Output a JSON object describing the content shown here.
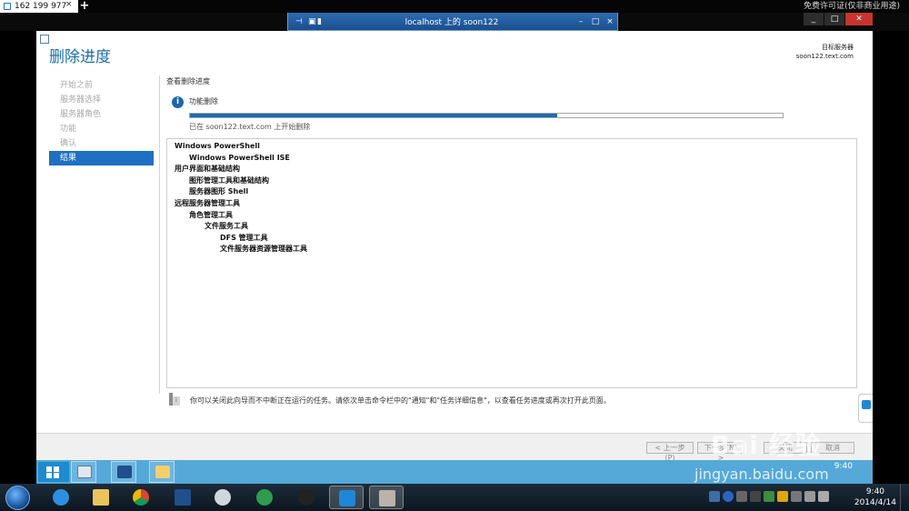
{
  "host_tab": {
    "title": "162 199 977",
    "close": "×",
    "new_tab": "+"
  },
  "host_top_right_text": "免费许可证(仅非商业用途)",
  "remote_bar": {
    "title": "localhost 上的 soon122",
    "minimize": "–",
    "restore": "□",
    "close": "×"
  },
  "window_controls": {
    "minimize": "_",
    "maximize": "□",
    "close": "✕"
  },
  "wizard": {
    "title": "删除进度",
    "target_label": "目标服务器",
    "target_server": "soon122.text.com",
    "nav": [
      {
        "label": "开始之前",
        "active": false
      },
      {
        "label": "服务器选择",
        "active": false
      },
      {
        "label": "服务器角色",
        "active": false
      },
      {
        "label": "功能",
        "active": false
      },
      {
        "label": "确认",
        "active": false
      },
      {
        "label": "结果",
        "active": true
      }
    ],
    "section_title": "查看删除进度",
    "feature_label": "功能删除",
    "progress_fraction": 0.62,
    "progress_text": "已在 soon122.text.com 上开始删除",
    "results": [
      {
        "text": "Windows PowerShell",
        "level": 0
      },
      {
        "text": "Windows PowerShell ISE",
        "level": 1
      },
      {
        "text": "用户界面和基础结构",
        "level": 0
      },
      {
        "text": "图形管理工具和基础结构",
        "level": 1
      },
      {
        "text": "服务器图形 Shell",
        "level": 1
      },
      {
        "text": "远程服务器管理工具",
        "level": 0
      },
      {
        "text": "角色管理工具",
        "level": 1
      },
      {
        "text": "文件服务工具",
        "level": 2
      },
      {
        "text": "DFS 管理工具",
        "level": 3
      },
      {
        "text": "文件服务器资源管理器工具",
        "level": 3
      }
    ],
    "note": "你可以关闭此向导而不中断正在运行的任务。请依次单击命令栏中的\"通知\"和\"任务详细信息\"，以查看任务进度或再次打开此页面。",
    "buttons": {
      "prev": "< 上一步(P)",
      "next": "下一步(N) >",
      "close": "关闭",
      "cancel": "取消"
    }
  },
  "server_taskbar": {
    "time": "9:40"
  },
  "host_taskbar": {
    "time": "9:40",
    "date": "2014/4/14"
  },
  "watermark": {
    "brand": "Bai 经验",
    "url": "jingyan.baidu.com"
  },
  "colors": {
    "accent": "#1a6db0",
    "nav_active": "#1e70c2",
    "server_taskbar": "#54a9d9"
  }
}
